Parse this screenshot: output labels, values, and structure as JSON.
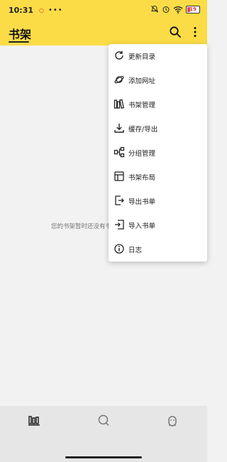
{
  "status_bar": {
    "time": "10:31",
    "battery": "19"
  },
  "app_bar": {
    "title": "书架"
  },
  "empty_state": {
    "text": "您的书架暂时还没有书"
  },
  "menu": {
    "items": [
      {
        "label": "更新目录",
        "icon": "refresh-icon"
      },
      {
        "label": "添加网址",
        "icon": "planet-icon"
      },
      {
        "label": "书架管理",
        "icon": "bookshelf-icon"
      },
      {
        "label": "缓存/导出",
        "icon": "download-icon"
      },
      {
        "label": "分组管理",
        "icon": "group-icon"
      },
      {
        "label": "书架布局",
        "icon": "layout-icon"
      },
      {
        "label": "导出书单",
        "icon": "export-icon"
      },
      {
        "label": "导入书单",
        "icon": "import-icon"
      },
      {
        "label": "日志",
        "icon": "info-icon"
      }
    ]
  },
  "bottom_nav": {
    "items": [
      "bookshelf-icon",
      "explore-icon",
      "profile-icon"
    ]
  },
  "colors": {
    "accent": "#fbdc47",
    "background": "#f2f2f2",
    "menu": "#ffffff"
  }
}
